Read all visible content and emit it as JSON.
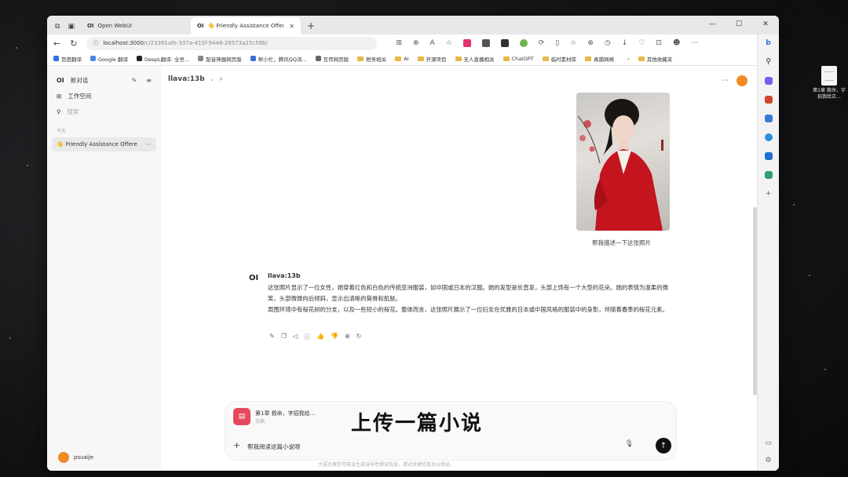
{
  "browser": {
    "tabs": [
      {
        "icon": "OI",
        "title": "Open WebUI"
      },
      {
        "icon": "OI",
        "title": "👋 Friendly Assistance Offere...",
        "active": true
      }
    ],
    "url_host": "localhost:3000",
    "url_path": "/c/23381afe-337a-415f-9448-28573a25c58b/",
    "bookmarks": [
      "百度翻译",
      "Google 翻译",
      "DeepL翻译: 全世...",
      "配音神器网页版",
      "帮小忙，腾讯QQ浏...",
      "互传网页版",
      "税务相关",
      "AI",
      "开源项目",
      "无人直播相关",
      "ChatGPT",
      "临时素材库",
      "真菌网络",
      "其他收藏夹"
    ]
  },
  "sidebar": {
    "logo": "OI",
    "new_chat": "新对话",
    "workspace": "工作空间",
    "search_placeholder": "搜索",
    "section_label": "今天",
    "chat_title": "Friendly Assistance Offere",
    "user_name": "psuaije"
  },
  "chat": {
    "model": "llava:13b",
    "user_caption": "帮我描述一下这张照片",
    "assistant_name": "llava:13b",
    "assistant_avatar": "OI",
    "assistant_text_1": "这张照片显示了一位女性，她穿着红色和白色的传统亚洲服装，如中国或日本的汉服。她的发型是长直发，头部上饰有一个大型的花朵。她的表情为温柔的微笑，头部微微向后倾斜，显示出清晰的鬓骨和肌肤。",
    "assistant_text_2": "周围环境中有桜花树的分支，以及一些短小的桜花。整体而言，这张照片展示了一位妇女在优雅的日本或中国风格的服装中的身影，伴随着春季的桜花元素。"
  },
  "composer": {
    "file_name": "第1章 救命，字招我给...",
    "file_type": "文档",
    "prompt_text": "帮我阅读这篇小说呀",
    "overlay_caption": "上传一篇小说",
    "disclaimer": "大语言模型可能会生成误导性错误信息，请对关键信息加以验证。"
  },
  "desktop": {
    "file_label": "第1章 救命，字招我给正..."
  },
  "colors": {
    "accent_orange": "#f08a24",
    "file_red": "#e5495b"
  }
}
